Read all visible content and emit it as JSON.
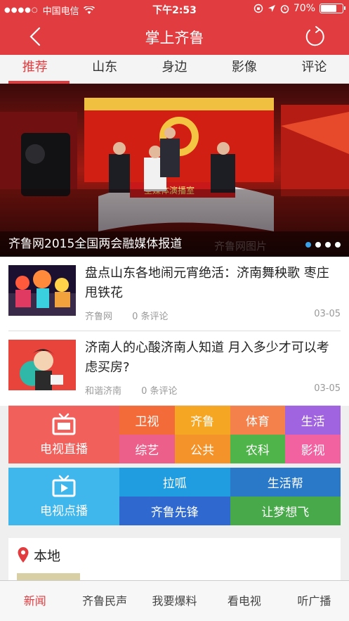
{
  "status_bar": {
    "carrier": "中国电信",
    "time": "下午2:53",
    "battery": "70%"
  },
  "header": {
    "title": "掌上齐鲁"
  },
  "tabs": [
    {
      "label": "推荐",
      "active": true
    },
    {
      "label": "山东",
      "active": false
    },
    {
      "label": "身边",
      "active": false
    },
    {
      "label": "影像",
      "active": false
    },
    {
      "label": "评论",
      "active": false
    }
  ],
  "hero": {
    "caption": "齐鲁网2015全国两会融媒体报道",
    "backdrop_text": "全媒体演播室",
    "watermark": "齐鲁网图片",
    "slides": 4,
    "active_slide": 1
  },
  "news": [
    {
      "title": "盘点山东各地闹元宵绝活：济南舞秧歌 枣庄甩铁花",
      "source": "齐鲁网",
      "comments": "0 条评论",
      "date": "03-05"
    },
    {
      "title": "济南人的心酸济南人知道 月入多少才可以考虑买房?",
      "source": "和谐济南",
      "comments": "0 条评论",
      "date": "03-05"
    }
  ],
  "live": {
    "label": "电视直播",
    "channels": [
      "卫视",
      "齐鲁",
      "体育",
      "生活",
      "综艺",
      "公共",
      "农科",
      "影视"
    ],
    "colors": [
      "#f26b38",
      "#f5a623",
      "#f4814c",
      "#a164e0",
      "#ec5f8b",
      "#f4932a",
      "#4fb44a",
      "#f262a1"
    ]
  },
  "vod": {
    "label": "电视点播",
    "programs": [
      "拉呱",
      "生活帮",
      "齐鲁先锋",
      "让梦想飞"
    ],
    "colors": [
      "#1f9de0",
      "#2a79c8",
      "#2f69d0",
      "#48a94a"
    ]
  },
  "local": {
    "label": "本地"
  },
  "bottom_tabs": [
    {
      "label": "新闻",
      "active": true
    },
    {
      "label": "齐鲁民声",
      "active": false
    },
    {
      "label": "我要爆料",
      "active": false
    },
    {
      "label": "看电视",
      "active": false
    },
    {
      "label": "听广播",
      "active": false
    }
  ],
  "colors": {
    "brand_red": "#e13c3f",
    "live_tile": "#f2605c",
    "vod_tile": "#3fb7ec"
  }
}
